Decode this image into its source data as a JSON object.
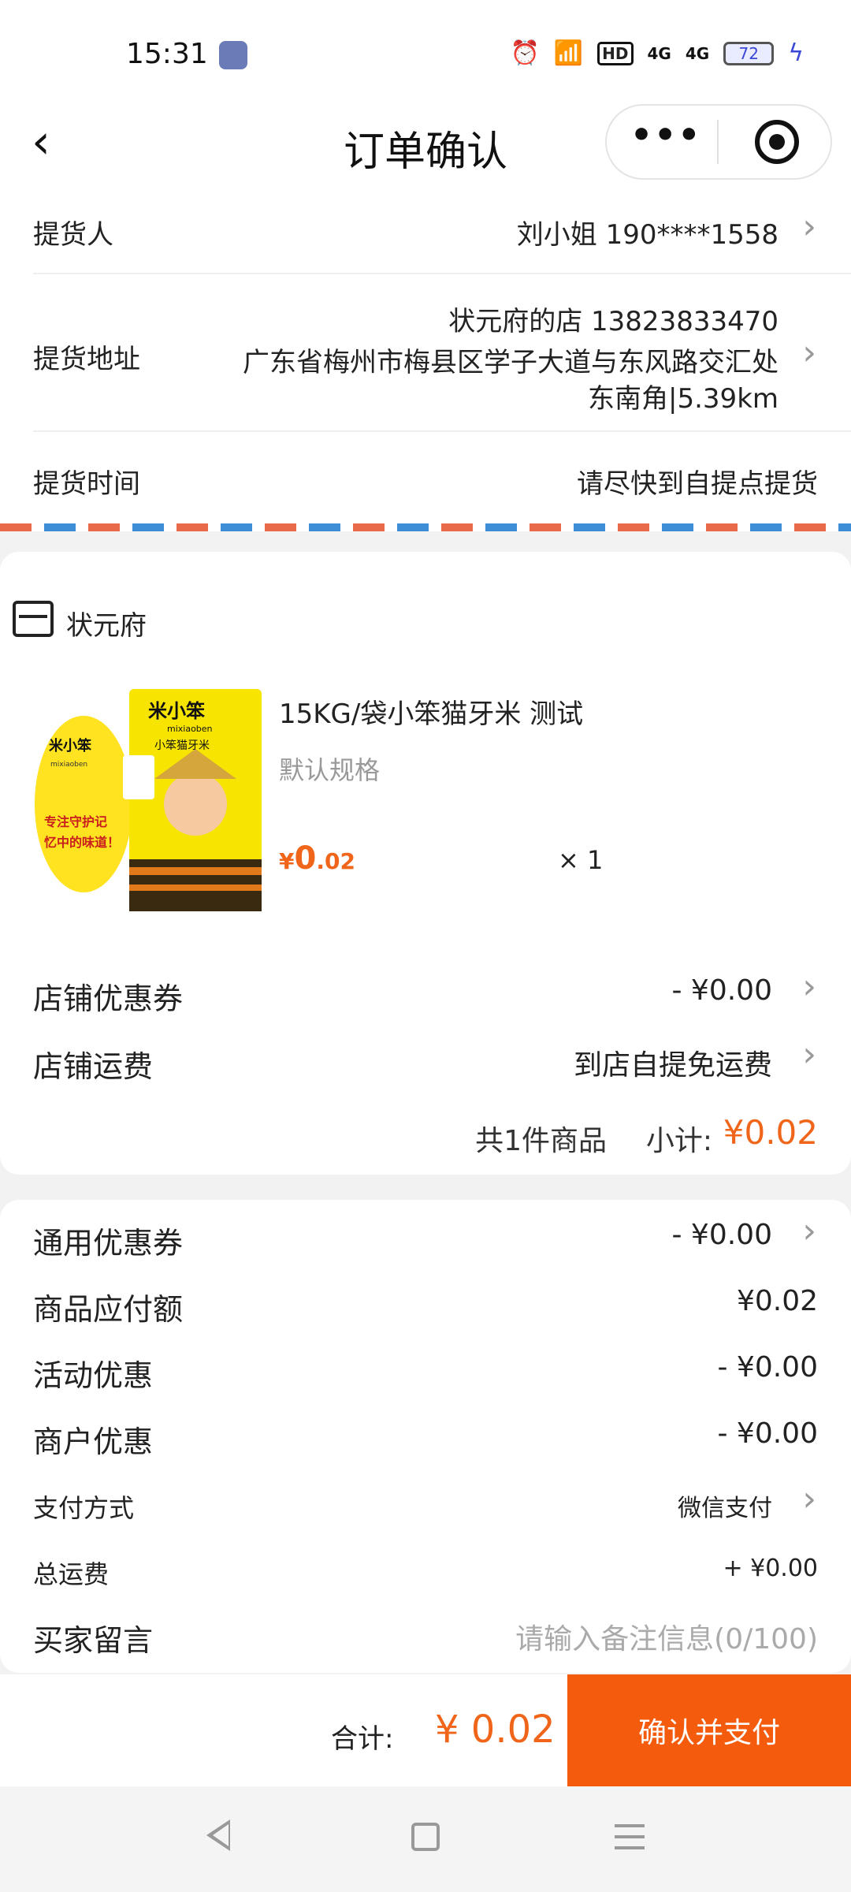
{
  "status_bar": {
    "time": "15:31",
    "icons": [
      "app-icon",
      "alarm-icon",
      "wifi-icon",
      "hd-icon",
      "signal-4g-icon",
      "signal-4g-icon",
      "battery-icon"
    ],
    "hd_label": "HD",
    "net1": "4G",
    "net2": "4G",
    "battery": "72"
  },
  "nav": {
    "back_glyph": "‹",
    "title": "订单确认",
    "more_glyph": "•••"
  },
  "pickup": {
    "person_label": "提货人",
    "person_value": "刘小姐 190****1558",
    "address_label": "提货地址",
    "address_line1": "状元府的店 13823833470",
    "address_line2": "广东省梅州市梅县区学子大道与东风路交汇处",
    "address_line3": "东南角|5.39km",
    "time_label": "提货时间",
    "time_value": "请尽快到自提点提货"
  },
  "store": {
    "name": "状元府",
    "product": {
      "name": "15KG/袋小笨猫牙米 测试",
      "spec": "默认规格",
      "price_symbol": "¥",
      "price_int": "0",
      "price_dec": ".02",
      "qty": "× 1",
      "img_brand": "米小笨",
      "img_sub": "mixiaoben",
      "img_product": "小笨猫牙米",
      "img_slogan1": "专注守护记",
      "img_slogan2": "忆中的味道！"
    },
    "coupon_label": "店铺优惠券",
    "coupon_value": "- ¥0.00",
    "shipping_label": "店铺运费",
    "shipping_value": "到店自提免运费",
    "count_text": "共1件商品",
    "subtotal_label": "小计:",
    "subtotal_value": "¥0.02"
  },
  "summary": {
    "rows": [
      {
        "label": "通用优惠券",
        "value": "- ¥0.00"
      },
      {
        "label": "商品应付额",
        "value": "¥0.02"
      },
      {
        "label": "活动优惠",
        "value": "- ¥0.00"
      },
      {
        "label": "商户优惠",
        "value": "- ¥0.00"
      },
      {
        "label": "支付方式",
        "value": "微信支付"
      },
      {
        "label": "总运费",
        "value": "+ ¥0.00"
      },
      {
        "label": "买家留言",
        "placeholder": "请输入备注信息(0/100)"
      }
    ]
  },
  "footer": {
    "total_label": "合计:",
    "total_value": "¥ 0.02",
    "pay_button": "确认并支付"
  },
  "colors": {
    "accent": "#f0651a",
    "pay_button": "#f45b0c",
    "airmail_red": "#e86a4b",
    "airmail_blue": "#3e8ed6"
  }
}
